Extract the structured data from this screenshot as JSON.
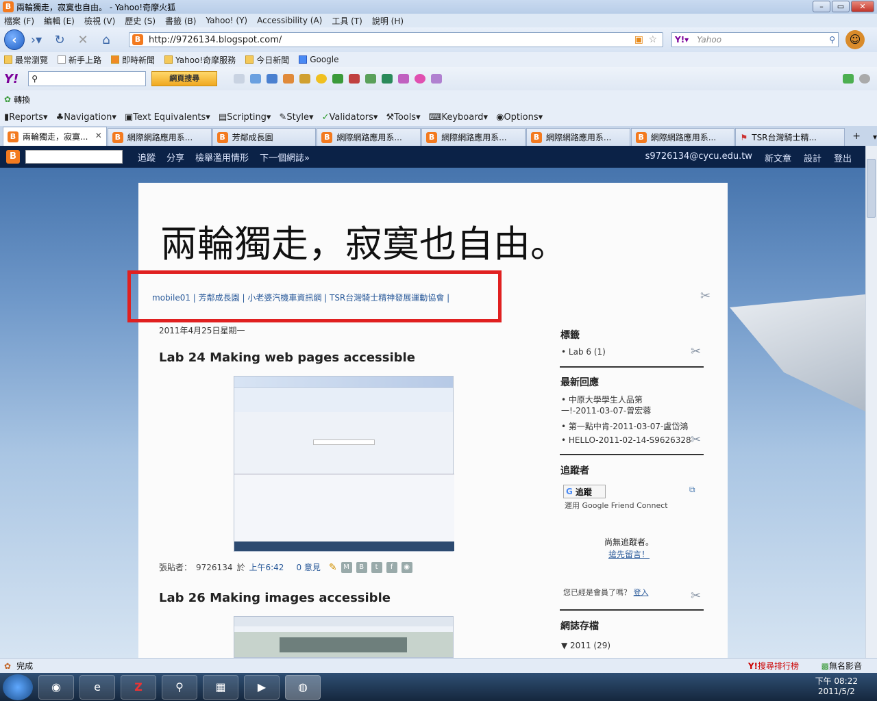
{
  "window": {
    "title": "兩輪獨走，寂寞也自由。 - Yahoo!奇摩火狐"
  },
  "menu": [
    "檔案 (F)",
    "編輯 (E)",
    "檢視 (V)",
    "歷史 (S)",
    "書籤 (B)",
    "Yahoo! (Y)",
    "Accessibility (A)",
    "工具 (T)",
    "說明 (H)"
  ],
  "nav": {
    "url": "http://9726134.blogspot.com/",
    "search_placeholder": "Yahoo"
  },
  "bookmarks": [
    "最常瀏覽",
    "新手上路",
    "即時新聞",
    "Yahoo!奇摩服務",
    "今日新聞",
    "Google"
  ],
  "yahoo_toolbar": {
    "button": "網頁搜尋"
  },
  "translate": {
    "label": "轉換"
  },
  "acc_toolbar": [
    "Reports▾",
    "Navigation▾",
    "Text Equivalents▾",
    "Scripting▾",
    "Style▾",
    "Validators▾",
    "Tools▾",
    "Keyboard▾",
    "Options▾"
  ],
  "tabs": [
    {
      "label": "兩輪獨走，寂寞..."
    },
    {
      "label": "網際網路應用系..."
    },
    {
      "label": "芳鄰成長園"
    },
    {
      "label": "網際網路應用系..."
    },
    {
      "label": "網際網路應用系..."
    },
    {
      "label": "網際網路應用系..."
    },
    {
      "label": "網際網路應用系..."
    },
    {
      "label": "TSR台灣騎士精..."
    }
  ],
  "blogger_bar": {
    "links": [
      "追蹤",
      "分享",
      "檢舉濫用情形",
      "下一個網誌»"
    ],
    "user": "s9726134@cycu.edu.tw",
    "right": [
      "新文章",
      "設計",
      "登出"
    ]
  },
  "blog": {
    "title": "兩輪獨走，寂寞也自由。",
    "linkbar": "mobile01 | 芳鄰成長園 | 小老婆汽機車資訊網 | TSR台灣騎士精神發展運動協會 |",
    "date": "2011年4月25日星期一",
    "post1_title": "Lab 24 Making web pages accessible",
    "post1_footer": {
      "prefix": "張貼者：",
      "author": "9726134",
      "at": "於",
      "time": "上午6:42",
      "comments": "0 意見"
    },
    "post2_title": "Lab 26 Making images accessible"
  },
  "sidebar": {
    "labels_title": "標籤",
    "labels": [
      "Lab 6 (1)"
    ],
    "comments_title": "最新回應",
    "comments": [
      "中原大學學生人品第一!-2011-03-07-曾宏蓉",
      "第一點中肯-2011-03-07-盧岱鴻",
      "HELLO-2011-02-14-S9626328"
    ],
    "followers_title": "追蹤者",
    "follow_button": "追蹤",
    "gfc": "運用 Google Friend Connect",
    "no_followers": "尚無追蹤者。",
    "first_comment": "搶先留言！",
    "member_q": "您已經是會員了嗎？",
    "login": "登入",
    "archive_title": "網誌存檔",
    "archive_year": "▼ 2011 (29)"
  },
  "status": {
    "text": "完成",
    "right1": "搜尋排行榜",
    "right2": "無名影音"
  },
  "clock": {
    "time": "下午 08:22",
    "date": "2011/5/2"
  }
}
